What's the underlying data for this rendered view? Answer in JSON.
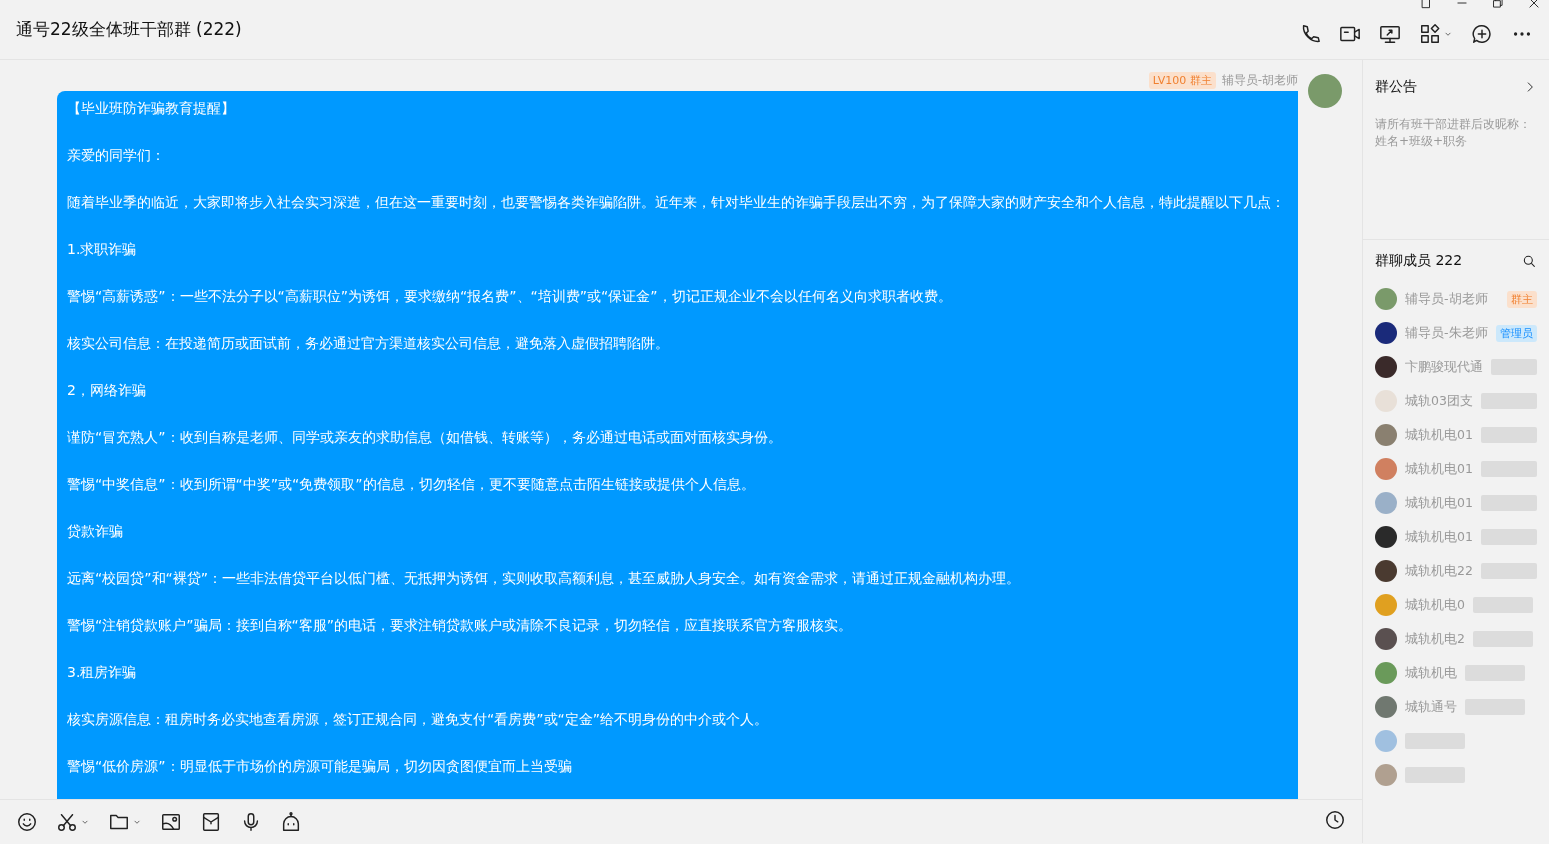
{
  "window": {
    "title": "通号22级全体班干部群 (222)"
  },
  "message": {
    "level_badge": "LV100 群主",
    "sender": "辅导员-胡老师",
    "paragraphs": [
      "【毕业班防诈骗教育提醒】",
      "亲爱的同学们：",
      "随着毕业季的临近，大家即将步入社会实习深造，但在这一重要时刻，也要警惕各类诈骗陷阱。近年来，针对毕业生的诈骗手段层出不穷，为了保障大家的财产安全和个人信息，特此提醒以下几点：",
      "1.求职诈骗",
      "警惕“高薪诱惑”：一些不法分子以“高薪职位”为诱饵，要求缴纳“报名费”、“培训费”或“保证金”，切记正规企业不会以任何名义向求职者收费。",
      "核实公司信息：在投递简历或面试前，务必通过官方渠道核实公司信息，避免落入虚假招聘陷阱。",
      "2，网络诈骗",
      "谨防“冒充熟人”：收到自称是老师、同学或亲友的求助信息（如借钱、转账等），务必通过电话或面对面核实身份。",
      "警惕“中奖信息”：收到所谓“中奖”或“免费领取”的信息，切勿轻信，更不要随意点击陌生链接或提供个人信息。",
      "贷款诈骗",
      "远离“校园贷”和“裸贷”：一些非法借贷平台以低门槛、无抵押为诱饵，实则收取高额利息，甚至威胁人身安全。如有资金需求，请通过正规金融机构办理。",
      "警惕“注销贷款账户”骗局：接到自称“客服”的电话，要求注销贷款账户或清除不良记录，切勿轻信，应直接联系官方客服核实。",
      "3.租房诈骗",
      "核实房源信息：租房时务必实地查看房源，签订正规合同，避免支付“看房费”或“定金”给不明身份的中介或个人。",
      "警惕“低价房源”：明显低于市场价的房源可能是骗局，切勿因贪图便宜而上当受骗"
    ]
  },
  "announcement": {
    "title": "群公告",
    "text": "请所有班干部进群后改昵称：姓名+班级+职务"
  },
  "members": {
    "title": "群聊成员 222",
    "items": [
      {
        "name": "辅导员-胡老师",
        "role": "群主",
        "kind": "owner"
      },
      {
        "name": "辅导员-朱老师",
        "role": "管理员",
        "kind": "admin"
      },
      {
        "name": "卞鹏骏现代通",
        "kind": "member"
      },
      {
        "name": "城轨03团支",
        "kind": "member"
      },
      {
        "name": "城轨机电01",
        "kind": "member"
      },
      {
        "name": "城轨机电01",
        "kind": "member"
      },
      {
        "name": "城轨机电01",
        "kind": "member"
      },
      {
        "name": "城轨机电01",
        "kind": "member"
      },
      {
        "name": "城轨机电22",
        "kind": "member"
      },
      {
        "name": "城轨机电0",
        "kind": "member"
      },
      {
        "name": "城轨机电2",
        "kind": "member"
      },
      {
        "name": "城轨机电",
        "kind": "member"
      },
      {
        "name": "城轨通号",
        "kind": "member"
      },
      {
        "kind": "member"
      },
      {
        "kind": "member"
      }
    ]
  }
}
